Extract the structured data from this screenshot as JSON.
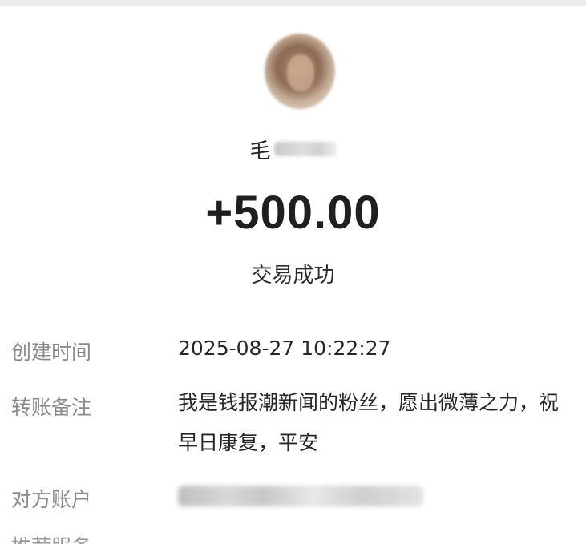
{
  "transaction": {
    "payer_name_visible": "毛",
    "amount": "+500.00",
    "status": "交易成功"
  },
  "details": {
    "created_time_label": "创建时间",
    "created_time_value": "2025-08-27 10:22:27",
    "note_label": "转账备注",
    "note_value": "我是钱报潮新闻的粉丝，愿出微薄之力，祝早日康复，平安",
    "account_label": "对方账户",
    "account_value_blurred": true,
    "next_label_partial": "推荐服务"
  },
  "colors": {
    "label_gray": "#8a8a8a",
    "text_dark": "#262626",
    "background": "#ffffff"
  }
}
